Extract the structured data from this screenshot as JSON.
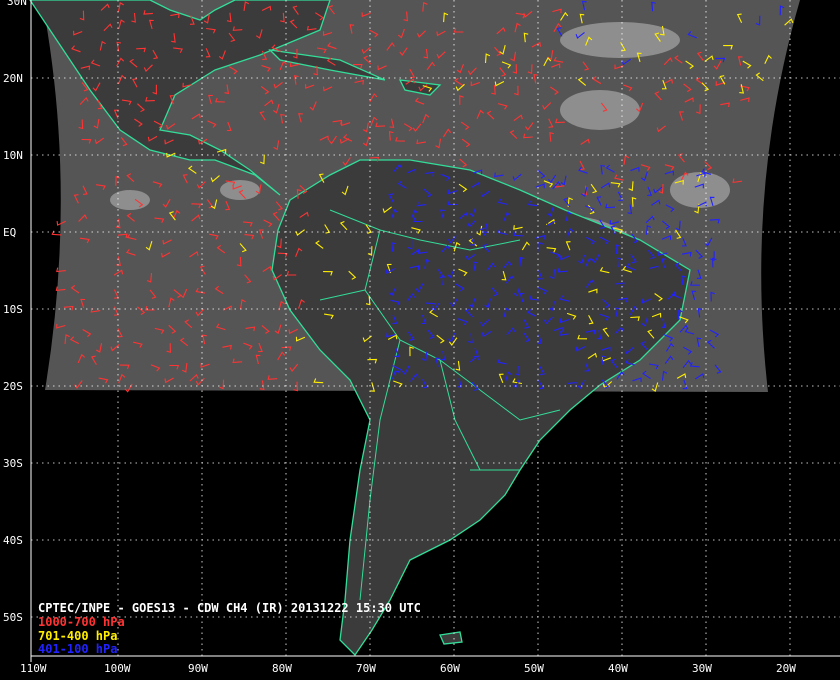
{
  "title": "CPTEC/INPE - GOES13 - CDW CH4 (IR) 20131222 15:30 UTC",
  "legend": [
    {
      "label": "1000-700 hPa",
      "color": "#ff3333"
    },
    {
      "label": "701-400 hPa",
      "color": "#ffee00"
    },
    {
      "label": "401-100 hPa",
      "color": "#2222ff"
    }
  ],
  "lat_labels": [
    "20N",
    "10N",
    "EQ",
    "10S",
    "20S",
    "30S",
    "40S",
    "50S"
  ],
  "lon_labels": [
    "110W",
    "100W",
    "90W",
    "80W",
    "70W",
    "60W",
    "50W",
    "40W",
    "30W",
    "20W"
  ],
  "top_partial_label": "30N",
  "coast_color": "#33dd99"
}
